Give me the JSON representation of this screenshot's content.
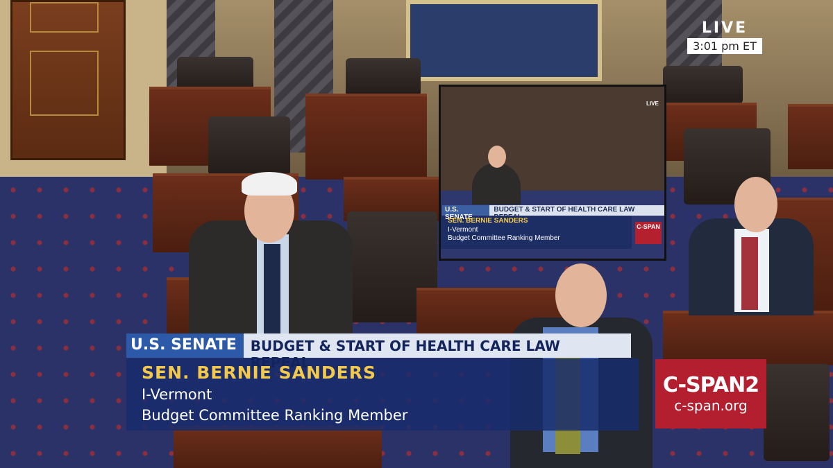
{
  "live": {
    "label": "LIVE",
    "time": "3:01 pm ET"
  },
  "chyron": {
    "chamber": "U.S. SENATE",
    "headline": "BUDGET & START OF HEALTH CARE LAW REPEAL",
    "name": "SEN. BERNIE SANDERS",
    "party": "I-Vermont",
    "title": "Budget Committee Ranking Member"
  },
  "logo": {
    "line1": "C-SPAN2",
    "line2": "c-span.org"
  },
  "monitor": {
    "chamber": "U.S. SENATE",
    "headline": "BUDGET & START OF HEALTH CARE LAW REPEAL",
    "name": "SEN. BERNIE SANDERS",
    "party": "I-Vermont",
    "title": "Budget Committee Ranking Member",
    "logo": "C-SPAN",
    "live": "LIVE"
  },
  "colors": {
    "chamber_bar": "#2d5aa8",
    "headline_bar": "#dfe6f2",
    "name_text": "#f2c94c",
    "logo_bg": "#b41f2f"
  }
}
